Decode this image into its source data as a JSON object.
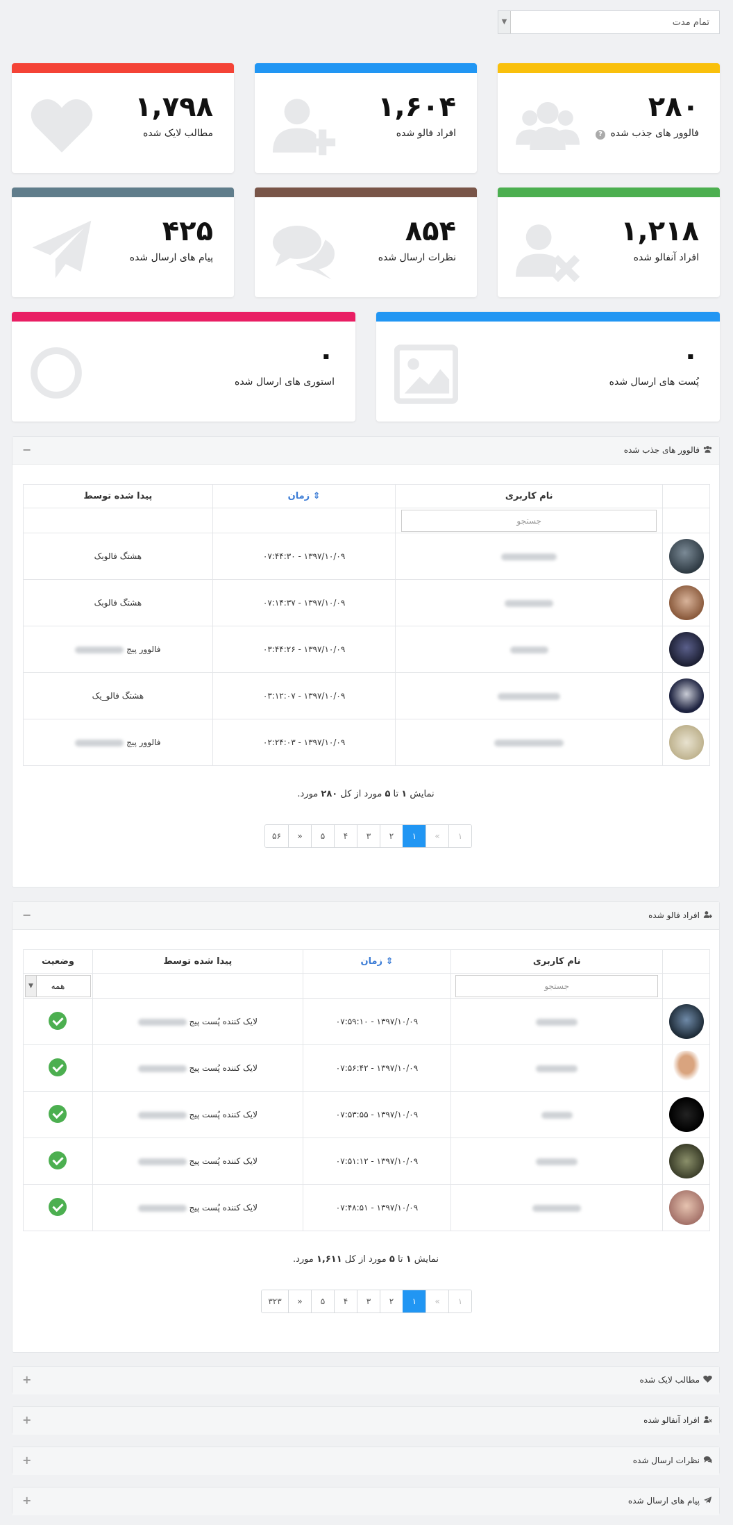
{
  "period_select": {
    "value": "تمام مدت"
  },
  "cards": [
    {
      "value": "۲۸۰",
      "label": "فالوور های جذب شده",
      "color": "#f9c00c",
      "icon": "users-icon",
      "help": "?"
    },
    {
      "value": "۱,۶۰۴",
      "label": "افراد فالو شده",
      "color": "#2196f3",
      "icon": "user-plus-icon"
    },
    {
      "value": "۱,۷۹۸",
      "label": "مطالب لایک شده",
      "color": "#f44336",
      "icon": "heart-icon"
    },
    {
      "value": "۱,۲۱۸",
      "label": "افراد آنفالو شده",
      "color": "#4caf50",
      "icon": "user-times-icon"
    },
    {
      "value": "۸۵۴",
      "label": "نظرات ارسال شده",
      "color": "#795548",
      "icon": "comments-icon"
    },
    {
      "value": "۴۲۵",
      "label": "پیام های ارسال شده",
      "color": "#607d8b",
      "icon": "paper-plane-icon"
    },
    {
      "value": "۰",
      "label": "پُست های ارسال شده",
      "color": "#2196f3",
      "icon": "image-icon"
    },
    {
      "value": "۰",
      "label": "استوری های ارسال شده",
      "color": "#e91e63",
      "icon": "circle-icon"
    }
  ],
  "panel1": {
    "title": "فالوور های جذب شده",
    "toggle": "−",
    "columns": {
      "username": "نام کاربری",
      "time": "زمان",
      "found_by": "پیدا شده توسط"
    },
    "search_placeholder": "جستجو",
    "rows": [
      {
        "time": "۱۳۹۷/۱۰/۰۹ - ۰۷:۴۴:۳۰",
        "found_by": "هشتگ فالوبک"
      },
      {
        "time": "۱۳۹۷/۱۰/۰۹ - ۰۷:۱۴:۳۷",
        "found_by": "هشتگ فالوبک"
      },
      {
        "time": "۱۳۹۷/۱۰/۰۹ - ۰۳:۴۴:۲۶",
        "found_by": "فالوور پیج"
      },
      {
        "time": "۱۳۹۷/۱۰/۰۹ - ۰۳:۱۲:۰۷",
        "found_by": "هشتگ فالو_یک"
      },
      {
        "time": "۱۳۹۷/۱۰/۰۹ - ۰۲:۲۴:۰۳",
        "found_by": "فالوور پیج"
      }
    ],
    "summary": {
      "pre": "نمایش",
      "from": "۱",
      "to_word": "تا",
      "to": "۵",
      "mid": "مورد از کل",
      "total": "۲۸۰",
      "post": "مورد."
    },
    "pages": [
      "۱",
      "«",
      "۱",
      "۲",
      "۳",
      "۴",
      "۵",
      "»",
      "۵۶"
    ]
  },
  "panel2": {
    "title": "افراد فالو شده",
    "toggle": "−",
    "columns": {
      "username": "نام کاربری",
      "time": "زمان",
      "found_by": "پیدا شده توسط",
      "status": "وضعیت"
    },
    "search_placeholder": "جستجو",
    "status_filter": "همه",
    "rows": [
      {
        "time": "۱۳۹۷/۱۰/۰۹ - ۰۷:۵۹:۱۰",
        "found_by": "لایک کننده پُست پیج"
      },
      {
        "time": "۱۳۹۷/۱۰/۰۹ - ۰۷:۵۶:۴۲",
        "found_by": "لایک کننده پُست پیج"
      },
      {
        "time": "۱۳۹۷/۱۰/۰۹ - ۰۷:۵۳:۵۵",
        "found_by": "لایک کننده پُست پیج"
      },
      {
        "time": "۱۳۹۷/۱۰/۰۹ - ۰۷:۵۱:۱۲",
        "found_by": "لایک کننده پُست پیج"
      },
      {
        "time": "۱۳۹۷/۱۰/۰۹ - ۰۷:۴۸:۵۱",
        "found_by": "لایک کننده پُست پیج"
      }
    ],
    "summary": {
      "pre": "نمایش",
      "from": "۱",
      "to_word": "تا",
      "to": "۵",
      "mid": "مورد از کل",
      "total": "۱,۶۱۱",
      "post": "مورد."
    },
    "pages": [
      "۱",
      "«",
      "۱",
      "۲",
      "۳",
      "۴",
      "۵",
      "»",
      "۳۲۳"
    ]
  },
  "collapsed_panels": [
    {
      "title": "مطالب لایک شده",
      "icon": "heart-icon",
      "toggle": "+"
    },
    {
      "title": "افراد آنفالو شده",
      "icon": "user-times-icon",
      "toggle": "+"
    },
    {
      "title": "نظرات ارسال شده",
      "icon": "comments-icon",
      "toggle": "+"
    },
    {
      "title": "پیام های ارسال شده",
      "icon": "paper-plane-icon",
      "toggle": "+"
    }
  ],
  "colors": {
    "accent": "#2196f3",
    "success": "#4caf50",
    "icon_gray": "#e7e8ea"
  }
}
